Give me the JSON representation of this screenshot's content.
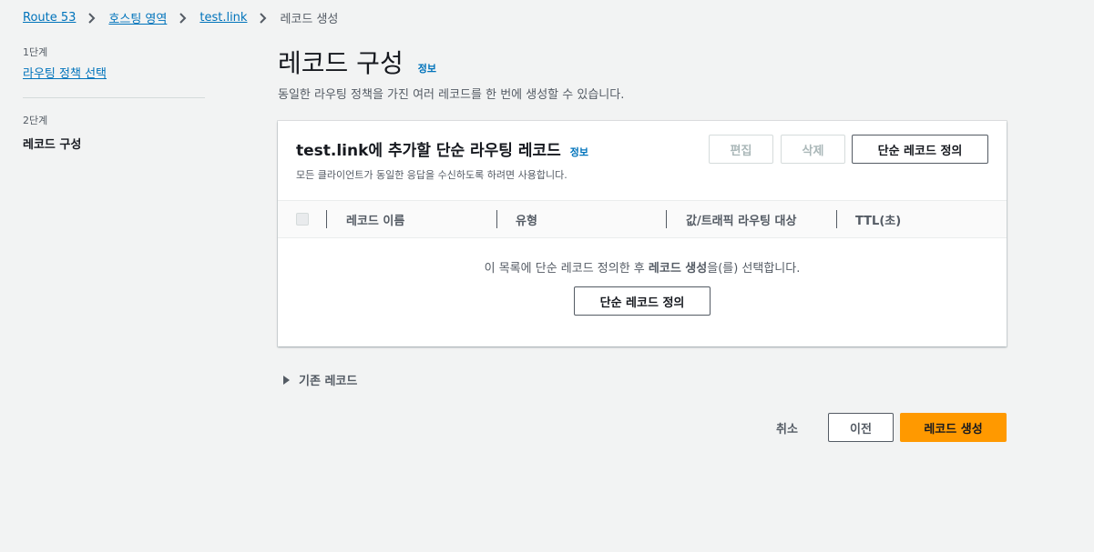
{
  "breadcrumb": {
    "items": [
      "Route 53",
      "호스팅 영역",
      "test.link"
    ],
    "current": "레코드 생성"
  },
  "steps": {
    "step1_label": "1단계",
    "step1_title": "라우팅 정책 선택",
    "step2_label": "2단계",
    "step2_title": "레코드 구성"
  },
  "page": {
    "title": "레코드 구성",
    "info": "정보",
    "subtitle": "동일한 라우팅 정책을 가진 여러 레코드를 한 번에 생성할 수 있습니다."
  },
  "panel": {
    "title": "test.link에 추가할 단순 라우팅 레코드",
    "info": "정보",
    "description": "모든 클라이언트가 동일한 응답을 수신하도록 하려면 사용합니다.",
    "edit_label": "편집",
    "delete_label": "삭제",
    "define_label": "단순 레코드 정의",
    "columns": [
      "레코드 이름",
      "유형",
      "값/트래픽 라우팅 대상",
      "TTL(초)"
    ],
    "empty_prefix": "이 목록에 단순 레코드 정의한 후 ",
    "empty_bold": "레코드 생성",
    "empty_suffix": "을(를) 선택합니다.",
    "empty_button": "단순 레코드 정의"
  },
  "existing_records": "기존 레코드",
  "footer": {
    "cancel": "취소",
    "previous": "이전",
    "create": "레코드 생성"
  },
  "colors": {
    "primary": "#ff9900",
    "link": "#0073bb",
    "background": "#f2f3f3"
  }
}
